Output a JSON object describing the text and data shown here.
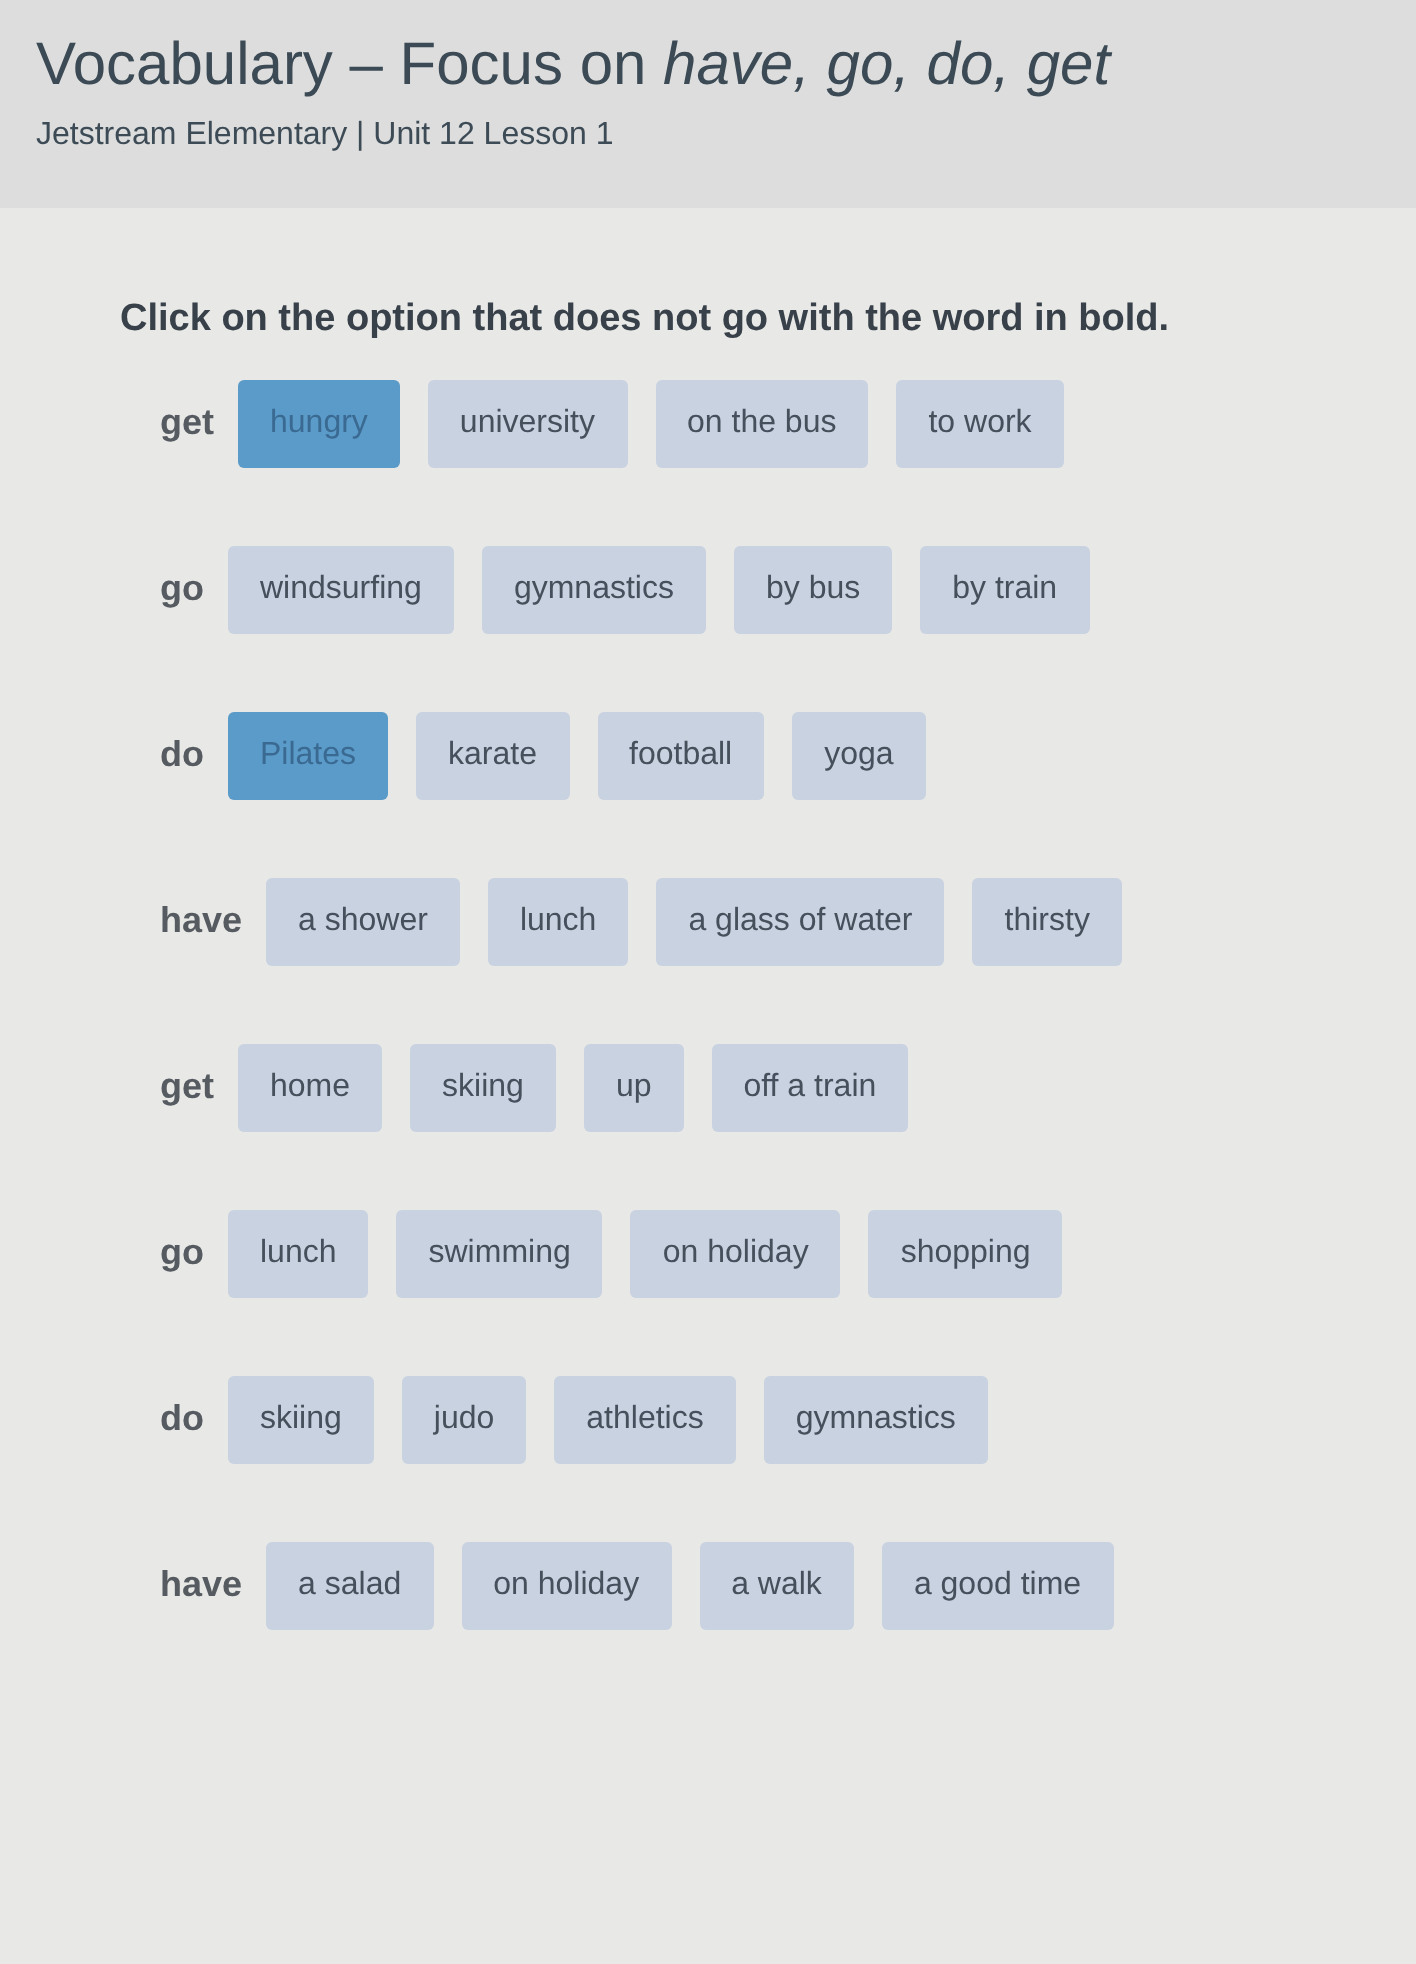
{
  "header": {
    "title": "Vocabulary – Focus on *have, go, do, get*",
    "subtitle": "Jetstream Elementary | Unit 12 Lesson 1"
  },
  "instruction": "Click on the option that does not go with the word in bold.",
  "questions": [
    {
      "word": "get",
      "options": [
        {
          "label": "hungry",
          "selected": true
        },
        {
          "label": "university",
          "selected": false
        },
        {
          "label": "on the bus",
          "selected": false
        },
        {
          "label": "to work",
          "selected": false
        }
      ]
    },
    {
      "word": "go",
      "options": [
        {
          "label": "windsurfing",
          "selected": false
        },
        {
          "label": "gymnastics",
          "selected": false
        },
        {
          "label": "by bus",
          "selected": false
        },
        {
          "label": "by train",
          "selected": false
        }
      ]
    },
    {
      "word": "do",
      "options": [
        {
          "label": "Pilates",
          "selected": true
        },
        {
          "label": "karate",
          "selected": false
        },
        {
          "label": "football",
          "selected": false
        },
        {
          "label": "yoga",
          "selected": false
        }
      ]
    },
    {
      "word": "have",
      "options": [
        {
          "label": "a shower",
          "selected": false
        },
        {
          "label": "lunch",
          "selected": false
        },
        {
          "label": "a glass of water",
          "selected": false
        },
        {
          "label": "thirsty",
          "selected": false
        }
      ]
    },
    {
      "word": "get",
      "options": [
        {
          "label": "home",
          "selected": false
        },
        {
          "label": "skiing",
          "selected": false
        },
        {
          "label": "up",
          "selected": false
        },
        {
          "label": "off a train",
          "selected": false
        }
      ]
    },
    {
      "word": "go",
      "options": [
        {
          "label": "lunch",
          "selected": false
        },
        {
          "label": "swimming",
          "selected": false
        },
        {
          "label": "on holiday",
          "selected": false
        },
        {
          "label": "shopping",
          "selected": false
        }
      ]
    },
    {
      "word": "do",
      "options": [
        {
          "label": "skiing",
          "selected": false
        },
        {
          "label": "judo",
          "selected": false
        },
        {
          "label": "athletics",
          "selected": false
        },
        {
          "label": "gymnastics",
          "selected": false
        }
      ]
    },
    {
      "word": "have",
      "options": [
        {
          "label": "a salad",
          "selected": false
        },
        {
          "label": "on holiday",
          "selected": false
        },
        {
          "label": "a walk",
          "selected": false
        },
        {
          "label": "a good time",
          "selected": false
        }
      ]
    }
  ]
}
